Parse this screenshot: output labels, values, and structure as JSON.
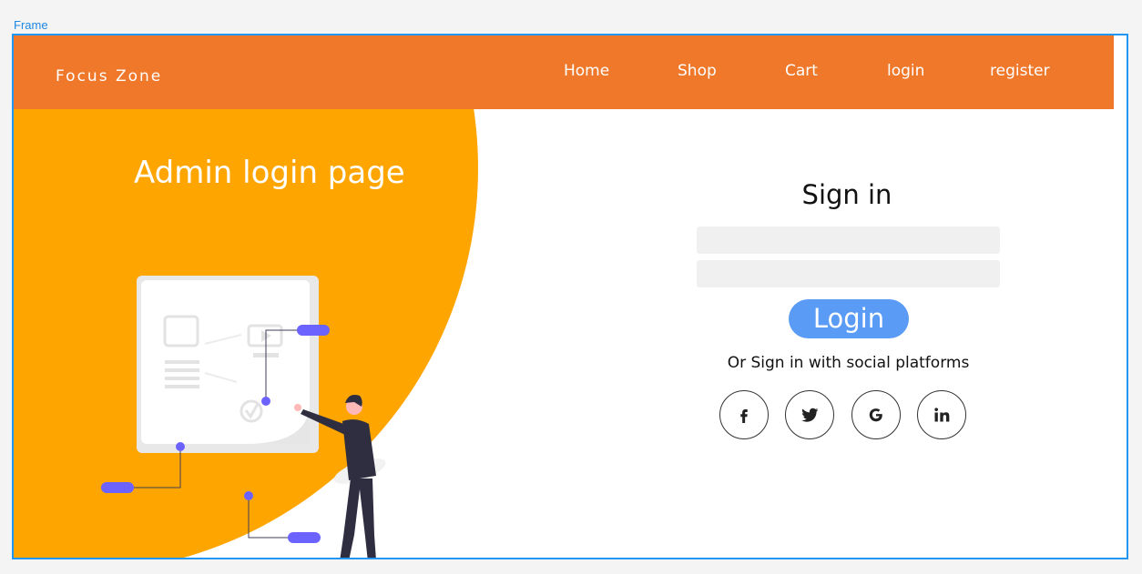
{
  "frame": {
    "label": "Frame"
  },
  "navbar": {
    "brand": "Focus Zone",
    "links": [
      {
        "label": "Home"
      },
      {
        "label": "Shop"
      },
      {
        "label": "Cart"
      },
      {
        "label": "login"
      },
      {
        "label": "register"
      }
    ]
  },
  "hero": {
    "title": "Admin login page",
    "illustration": "person-presenting-dashboard-illustration"
  },
  "signin": {
    "title": "Sign in",
    "username_value": "",
    "password_value": "",
    "login_label": "Login",
    "social_text": "Or Sign in with social platforms",
    "social_icons": [
      "facebook-icon",
      "twitter-icon",
      "google-icon",
      "linkedin-icon"
    ]
  },
  "colors": {
    "navbar": "#ef782a",
    "hero_circle": "#ffa500",
    "login_button": "#5a9bf6",
    "input_bg": "#f0f0f0",
    "frame_border": "#2196f3",
    "accent_purple": "#6c63ff"
  }
}
